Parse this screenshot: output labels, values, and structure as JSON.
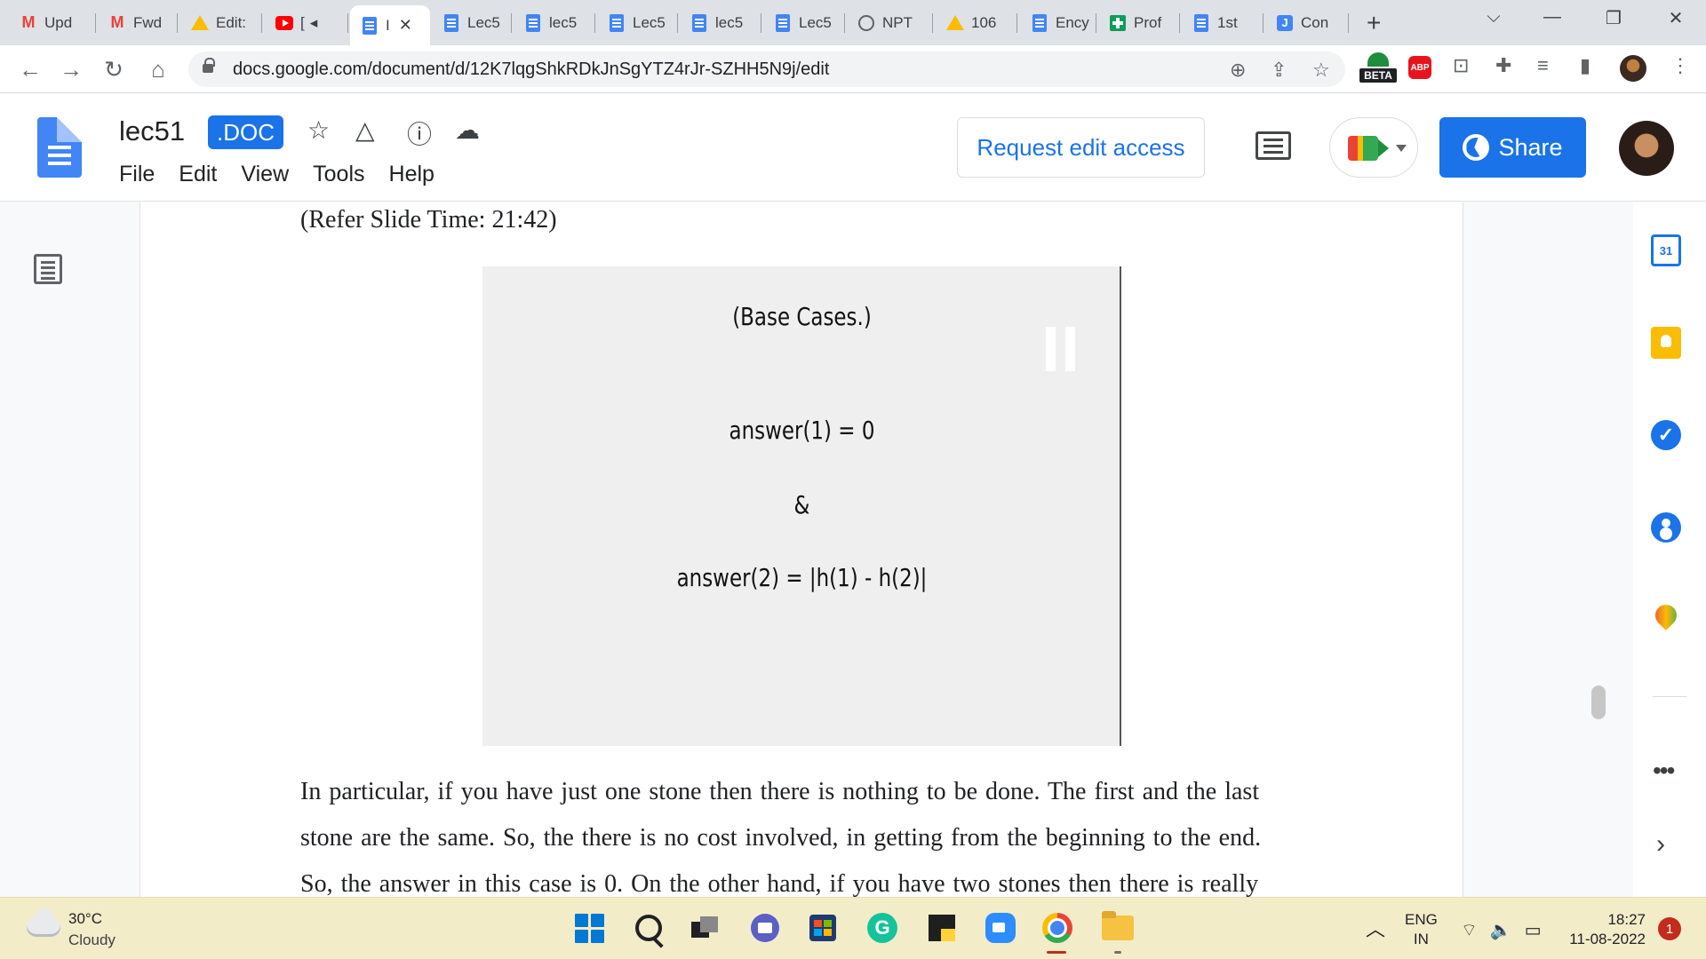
{
  "browser": {
    "tabs": [
      {
        "label": "Upd",
        "icon": "gmail-icon"
      },
      {
        "label": "Fwd",
        "icon": "gmail-icon"
      },
      {
        "label": "Edit:",
        "icon": "drive-icon"
      },
      {
        "label": "[",
        "icon": "youtube-icon"
      },
      {
        "label": "I",
        "icon": "docs-icon",
        "active": true
      },
      {
        "label": "Lec5",
        "icon": "docs-icon"
      },
      {
        "label": "lec5",
        "icon": "docs-icon"
      },
      {
        "label": "Lec5",
        "icon": "docs-icon"
      },
      {
        "label": "lec5",
        "icon": "docs-icon"
      },
      {
        "label": "Lec5",
        "icon": "docs-icon"
      },
      {
        "label": "NPT",
        "icon": "globe-icon"
      },
      {
        "label": "106",
        "icon": "drive-icon"
      },
      {
        "label": "Ency",
        "icon": "docs-icon"
      },
      {
        "label": "Prof",
        "icon": "sheets-plus-icon"
      },
      {
        "label": "1st",
        "icon": "docs-icon"
      },
      {
        "label": "Con",
        "icon": "j-icon"
      }
    ],
    "url": "docs.google.com/document/d/12K7lqgShkRDkJnSgYTZ4rJr-SZHH5N9j/edit",
    "extension_badge": "BETA",
    "abp_label": "ABP"
  },
  "docs": {
    "title": "lec51",
    "badge": ".DOC",
    "menu": [
      "File",
      "Edit",
      "View",
      "Tools",
      "Help"
    ],
    "request_edit_label": "Request edit access",
    "share_label": "Share"
  },
  "document": {
    "refer": "(Refer Slide Time: 21:42)",
    "slide": {
      "heading": "(Base Cases.)",
      "line1": "answer(1) = 0",
      "connector": "&",
      "line2": "answer(2) = |h(1) - h(2)|"
    },
    "paragraph_lines": [
      "In particular, if you have just one stone then there is nothing to be done. The first and the last",
      "stone are the same. So, the there is no cost involved, in getting from the beginning to the end.",
      "So, the answer in this case is 0. On the other hand, if you have two stones then there is really"
    ]
  },
  "side_panel": {
    "calendar_day": "31"
  },
  "taskbar": {
    "temperature": "30°C",
    "condition": "Cloudy",
    "language": "ENG",
    "region": "IN",
    "time": "18:27",
    "date": "11-08-2022",
    "notification_count": "1"
  }
}
